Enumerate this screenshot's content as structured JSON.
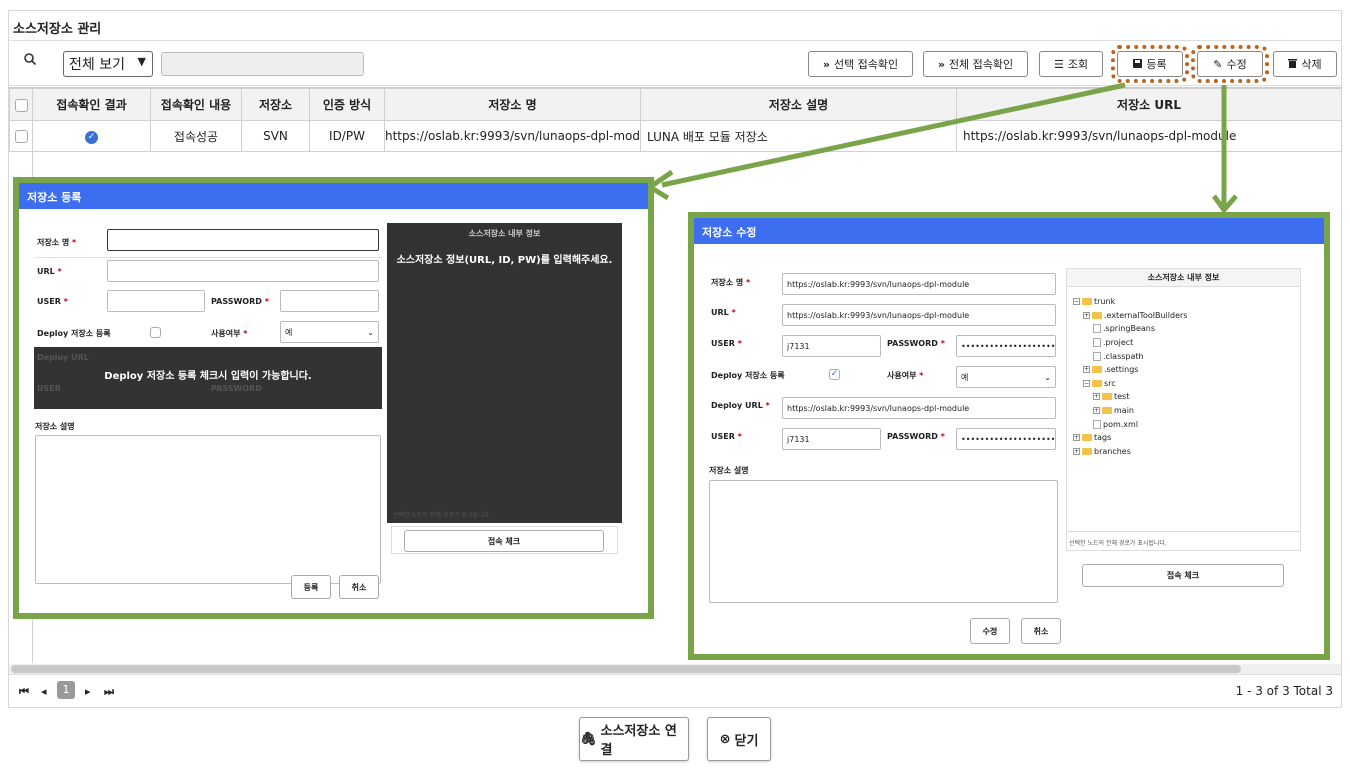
{
  "page_title": "소스저장소 관리",
  "toolbar": {
    "filter_value": "전체 보기",
    "search_value": "",
    "buttons": {
      "selected_check": "선택 접속확인",
      "all_check": "전체 접속확인",
      "view": "조회",
      "register": "등록",
      "edit": "수정",
      "delete": "삭제"
    }
  },
  "table": {
    "headers": [
      "접속확인 결과",
      "접속확인 내용",
      "저장소",
      "인증 방식",
      "저장소 명",
      "저장소 설명",
      "저장소 URL"
    ],
    "rows": [
      {
        "status_icon": "check-circle-icon",
        "content": "접속성공",
        "repo_type": "SVN",
        "auth": "ID/PW",
        "name": "https://oslab.kr:9993/svn/lunaops-dpl-module",
        "desc": "LUNA 배포 모듈 저장소",
        "url": "https://oslab.kr:9993/svn/lunaops-dpl-module"
      }
    ]
  },
  "pager": {
    "current": "1",
    "info": "1 - 3 of 3  Total 3"
  },
  "footer": {
    "connect": "소스저장소 연결",
    "close": "닫기"
  },
  "register_dialog": {
    "title": "저장소 등록",
    "labels": {
      "name": "저장소 명",
      "url": "URL",
      "user": "USER",
      "password": "PASSWORD",
      "deploy": "Deploy 저장소 등록",
      "use": "사용여부",
      "deploy_url": "Deploy URL",
      "user2": "USER",
      "password2": "PASSWORD",
      "desc": "저장소 설명"
    },
    "values": {
      "name": "",
      "url": "",
      "user": "",
      "password": "",
      "use": "예"
    },
    "deploy_overlay": "Deploy 저장소 등록 체크시 입력이 가능합니다.",
    "info_title": "소스저장소 내부 정보",
    "info_message": "소스저장소 정보(URL, ID, PW)를 입력해주세요.",
    "info_footer": "선택한 노드의 전체 경로가 표시됩니다.",
    "check_button": "접속 체크",
    "submit": "등록",
    "cancel": "취소"
  },
  "edit_dialog": {
    "title": "저장소 수정",
    "labels": {
      "name": "저장소 명",
      "url": "URL",
      "user": "USER",
      "password": "PASSWORD",
      "deploy": "Deploy 저장소 등록",
      "use": "사용여부",
      "deploy_url": "Deploy URL",
      "user2": "USER",
      "password2": "PASSWORD",
      "desc": "저장소 설명"
    },
    "values": {
      "name": "https://oslab.kr:9993/svn/lunaops-dpl-module",
      "url": "https://oslab.kr:9993/svn/lunaops-dpl-module",
      "user": "j7131",
      "password": "••••••••••••••••••••••••",
      "use": "예",
      "deploy_url": "https://oslab.kr:9993/svn/lunaops-dpl-module",
      "user2": "j7131",
      "password2": "••••••••••••••••••••••••"
    },
    "info_title": "소스저장소 내부 정보",
    "tree": {
      "trunk": "trunk",
      "externalToolBuilders": ".externalToolBuilders",
      "springBeans": ".springBeans",
      "project": ".project",
      "classpath": ".classpath",
      "settings": ".settings",
      "src": "src",
      "test": "test",
      "main": "main",
      "pom": "pom.xml",
      "tags": "tags",
      "branches": "branches"
    },
    "info_footer": "선택한 노드의 전체 경로가 표시됩니다.",
    "check_button": "접속 체크",
    "submit": "수정",
    "cancel": "취소"
  },
  "colors": {
    "header_blue": "#3d6ef0",
    "highlight_green": "#7aa44a",
    "highlight_orange": "#c0631a"
  }
}
